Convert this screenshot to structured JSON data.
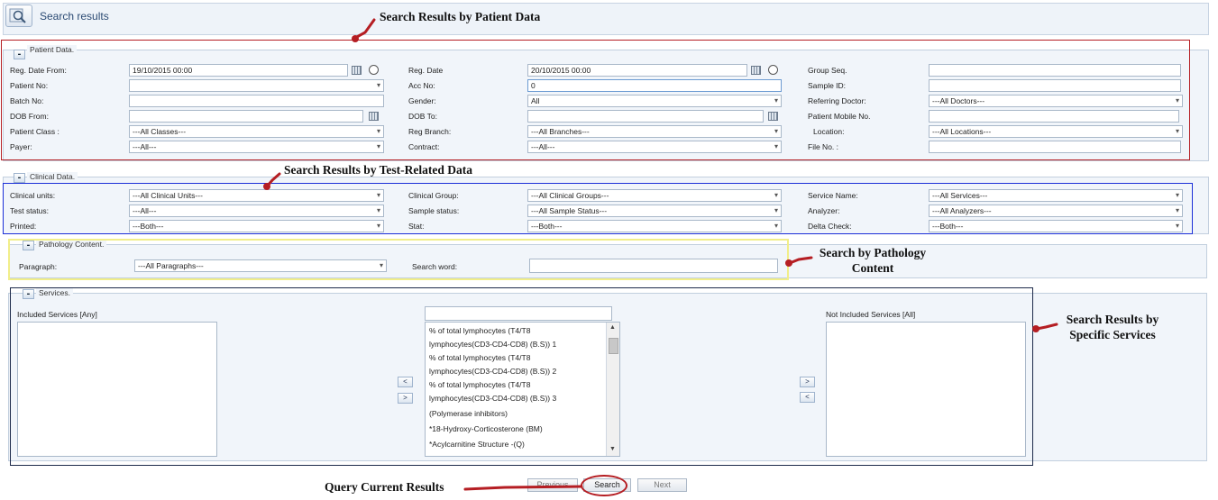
{
  "header": {
    "title": "Search results",
    "icon": "search-icon"
  },
  "patient_data": {
    "legend": "Patient Data.",
    "toggle": "-",
    "fields": [
      {
        "label": "Reg. Date From:",
        "value": "19/10/2015 00:00"
      },
      {
        "label": "Reg. Date",
        "value": "20/10/2015 00:00"
      },
      {
        "label": "Group Seq.",
        "value": ""
      },
      {
        "label": "Patient No:",
        "value": ""
      },
      {
        "label": "Acc No:",
        "value": "0"
      },
      {
        "label": "Sample ID:",
        "value": ""
      },
      {
        "label": "Batch No:",
        "value": ""
      },
      {
        "label": "Gender:",
        "value": "All"
      },
      {
        "label": "Referring Doctor:",
        "value": "---All Doctors---"
      },
      {
        "label": "DOB From:",
        "value": ""
      },
      {
        "label": "DOB To:",
        "value": ""
      },
      {
        "label": "Patient Mobile No.",
        "value": ""
      },
      {
        "label": "Patient Class :",
        "value": "---All Classes---"
      },
      {
        "label": "Reg Branch:",
        "value": "---All Branches---"
      },
      {
        "label": "Location:",
        "value": "---All Locations---"
      },
      {
        "label": "Payer:",
        "value": "---All---"
      },
      {
        "label": "Contract:",
        "value": "---All---"
      },
      {
        "label": "File No. :",
        "value": ""
      }
    ]
  },
  "clinical_data": {
    "legend": "Clinical Data.",
    "toggle": "-",
    "fields": [
      {
        "label": "Clinical units:",
        "value": "---All Clinical Units---"
      },
      {
        "label": "Clinical Group:",
        "value": "---All Clinical Groups---"
      },
      {
        "label": "Service Name:",
        "value": "---All Services---"
      },
      {
        "label": "Test status:",
        "value": "---All---"
      },
      {
        "label": "Sample status:",
        "value": "---All Sample Status---"
      },
      {
        "label": "Analyzer:",
        "value": "---All Analyzers---"
      },
      {
        "label": "Printed:",
        "value": "---Both---"
      },
      {
        "label": "Stat:",
        "value": "---Both---"
      },
      {
        "label": "Delta Check:",
        "value": "---Both---"
      }
    ]
  },
  "pathology": {
    "legend": "Pathology Content.",
    "toggle": "-",
    "paragraph_label": "Paragraph:",
    "paragraph_value": "---All Paragraphs---",
    "search_word_label": "Search word:",
    "search_word_value": ""
  },
  "services": {
    "legend": "Services.",
    "toggle": "-",
    "included_label": "Included Services [Any]",
    "not_included_label": "Not Included Services [All]",
    "filter_value": "",
    "items": [
      "% of total lymphocytes (T4/T8",
      "lymphocytes(CD3-CD4-CD8) (B.S)) 1",
      "% of total lymphocytes (T4/T8",
      "lymphocytes(CD3-CD4-CD8) (B.S)) 2",
      "% of total lymphocytes (T4/T8",
      "lymphocytes(CD3-CD4-CD8) (B.S)) 3",
      "(Polymerase inhibitors)",
      "*18-Hydroxy-Corticosterone (BM)",
      "*Acylcarnitine Structure -(Q)"
    ],
    "buttons": {
      "remove": "<",
      "add": ">",
      "move_right": ">",
      "move_left": "<"
    }
  },
  "buttons": {
    "previous": "Previous",
    "search": "Search",
    "next": "Next"
  },
  "annotations": {
    "patient": "Search Results by Patient Data",
    "clinical": "Search Results by Test-Related Data",
    "pathology": "Search by Pathology Content",
    "services": "Search Results by Specific Services",
    "query": "Query Current Results"
  },
  "colors": {
    "annotation_red": "#b51e23",
    "annotation_blue": "#1c2fd8",
    "annotation_yellow": "#f1ee8a",
    "annotation_navy": "#1d2a4a",
    "panel_bg": "#f1f5fa"
  }
}
